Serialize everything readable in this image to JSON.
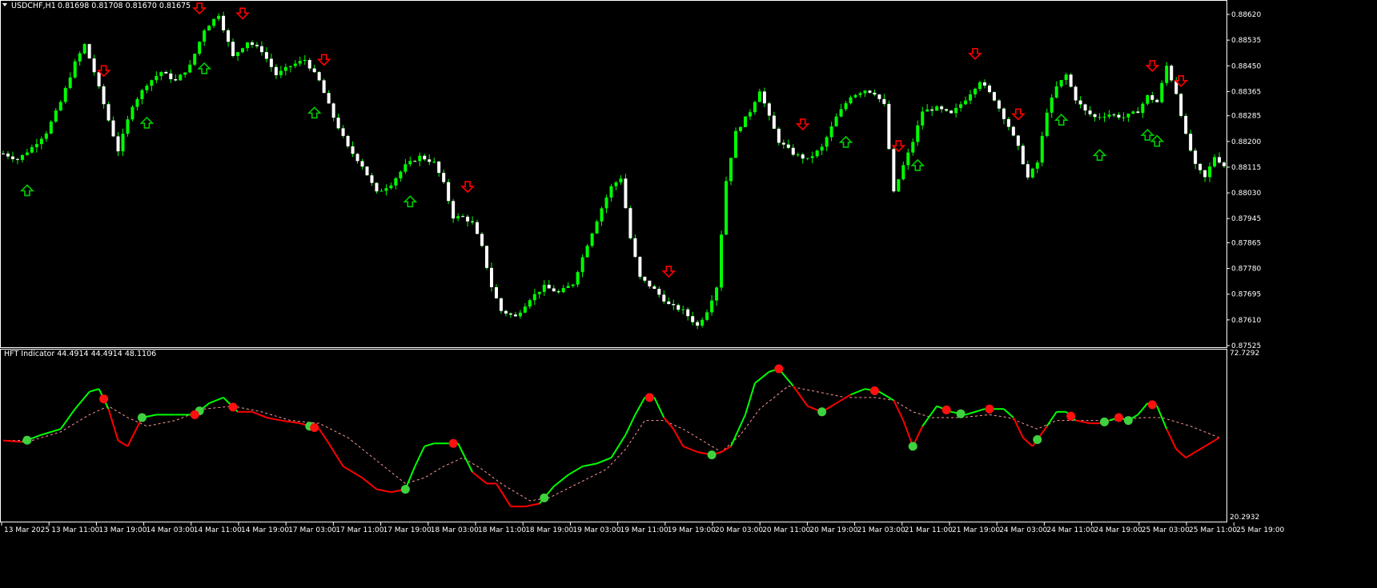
{
  "header": {
    "symbol": "USDCHF,H1",
    "ohlc": "0.81698 0.81708 0.81670 0.81675"
  },
  "indicator": {
    "title": "HFT Indicator 44.4914 44.4914 48.1106",
    "max_label": "72.7292",
    "min_label": "20.2932"
  },
  "colors": {
    "background": "#000000",
    "bull": "#00ff00",
    "bear": "#ffffff",
    "buy_arrow": "#00cc00",
    "sell_arrow": "#ff0000",
    "axis": "#ffffff",
    "signal_line": "#ff9999"
  },
  "price_axis": {
    "ticks": [
      "0.88620",
      "0.88535",
      "0.88450",
      "0.88365",
      "0.88285",
      "0.88200",
      "0.88115",
      "0.88030",
      "0.87945",
      "0.87865",
      "0.87780",
      "0.87695",
      "0.87610",
      "0.87525"
    ],
    "ylim": [
      0.87525,
      0.88665
    ]
  },
  "time_axis": {
    "labels": [
      "13 Mar 2025",
      "13 Mar 11:00",
      "13 Mar 19:00",
      "14 Mar 03:00",
      "14 Mar 11:00",
      "14 Mar 19:00",
      "17 Mar 03:00",
      "17 Mar 11:00",
      "17 Mar 19:00",
      "18 Mar 03:00",
      "18 Mar 11:00",
      "18 Mar 19:00",
      "19 Mar 03:00",
      "19 Mar 11:00",
      "19 Mar 19:00",
      "20 Mar 03:00",
      "20 Mar 11:00",
      "20 Mar 19:00",
      "21 Mar 03:00",
      "21 Mar 11:00",
      "21 Mar 19:00",
      "24 Mar 03:00",
      "24 Mar 11:00",
      "24 Mar 19:00",
      "25 Mar 03:00",
      "25 Mar 11:00",
      "25 Mar 19:00"
    ]
  },
  "chart_data": {
    "type": "candlestick",
    "title": "USDCHF,H1",
    "ylim": [
      0.87525,
      0.88665
    ],
    "close_path": [
      [
        0,
        0.8816
      ],
      [
        3,
        0.8814
      ],
      [
        6,
        0.8818
      ],
      [
        9,
        0.8823
      ],
      [
        12,
        0.8833
      ],
      [
        15,
        0.8846
      ],
      [
        17,
        0.8852
      ],
      [
        19,
        0.8843
      ],
      [
        22,
        0.8827
      ],
      [
        24,
        0.8817
      ],
      [
        27,
        0.8832
      ],
      [
        30,
        0.8839
      ],
      [
        33,
        0.8843
      ],
      [
        36,
        0.884
      ],
      [
        39,
        0.8845
      ],
      [
        42,
        0.8857
      ],
      [
        45,
        0.8862
      ],
      [
        48,
        0.8848
      ],
      [
        51,
        0.8853
      ],
      [
        54,
        0.885
      ],
      [
        57,
        0.8842
      ],
      [
        60,
        0.8845
      ],
      [
        63,
        0.8847
      ],
      [
        66,
        0.884
      ],
      [
        69,
        0.8828
      ],
      [
        72,
        0.8818
      ],
      [
        75,
        0.8812
      ],
      [
        78,
        0.8803
      ],
      [
        81,
        0.8806
      ],
      [
        84,
        0.8812
      ],
      [
        87,
        0.8815
      ],
      [
        90,
        0.8813
      ],
      [
        92,
        0.8806
      ],
      [
        94,
        0.8795
      ],
      [
        96,
        0.8795
      ],
      [
        98,
        0.8793
      ],
      [
        100,
        0.8785
      ],
      [
        102,
        0.8772
      ],
      [
        104,
        0.8764
      ],
      [
        107,
        0.8762
      ],
      [
        110,
        0.8768
      ],
      [
        113,
        0.8772
      ],
      [
        116,
        0.877
      ],
      [
        119,
        0.8773
      ],
      [
        122,
        0.8786
      ],
      [
        125,
        0.8798
      ],
      [
        127,
        0.8805
      ],
      [
        129,
        0.8808
      ],
      [
        131,
        0.8788
      ],
      [
        133,
        0.8775
      ],
      [
        136,
        0.8771
      ],
      [
        139,
        0.8766
      ],
      [
        142,
        0.8764
      ],
      [
        145,
        0.8759
      ],
      [
        147,
        0.8764
      ],
      [
        149,
        0.8772
      ],
      [
        151,
        0.8807
      ],
      [
        153,
        0.8823
      ],
      [
        156,
        0.883
      ],
      [
        158,
        0.8837
      ],
      [
        160,
        0.8828
      ],
      [
        162,
        0.882
      ],
      [
        165,
        0.8816
      ],
      [
        168,
        0.8814
      ],
      [
        171,
        0.8818
      ],
      [
        174,
        0.8828
      ],
      [
        177,
        0.8835
      ],
      [
        180,
        0.8837
      ],
      [
        182,
        0.8836
      ],
      [
        184,
        0.8832
      ],
      [
        186,
        0.8803
      ],
      [
        188,
        0.8812
      ],
      [
        190,
        0.882
      ],
      [
        192,
        0.883
      ],
      [
        195,
        0.8831
      ],
      [
        198,
        0.8829
      ],
      [
        201,
        0.8834
      ],
      [
        204,
        0.884
      ],
      [
        207,
        0.8834
      ],
      [
        210,
        0.8825
      ],
      [
        212,
        0.8818
      ],
      [
        214,
        0.8808
      ],
      [
        216,
        0.8813
      ],
      [
        218,
        0.883
      ],
      [
        220,
        0.8838
      ],
      [
        222,
        0.8842
      ],
      [
        224,
        0.8834
      ],
      [
        226,
        0.883
      ],
      [
        228,
        0.8828
      ],
      [
        231,
        0.8829
      ],
      [
        234,
        0.8828
      ],
      [
        237,
        0.883
      ],
      [
        239,
        0.8835
      ],
      [
        241,
        0.8833
      ],
      [
        243,
        0.8845
      ],
      [
        245,
        0.8836
      ],
      [
        247,
        0.8822
      ],
      [
        249,
        0.8812
      ],
      [
        251,
        0.8808
      ],
      [
        253,
        0.8815
      ],
      [
        255,
        0.8812
      ]
    ],
    "buy_signals": [
      5,
      30,
      42,
      65,
      85,
      176,
      191,
      221,
      229,
      239,
      241
    ],
    "sell_signals": [
      21,
      41,
      50,
      67,
      97,
      139,
      167,
      187,
      203,
      212,
      240,
      246
    ],
    "indicator": {
      "name": "HFT Indicator",
      "values": [
        44.4914,
        44.4914,
        48.1106
      ],
      "ylim": [
        20.2932,
        72.7292
      ],
      "main_line": [
        [
          0,
          48
        ],
        [
          4,
          47.5
        ],
        [
          8,
          50
        ],
        [
          12,
          52
        ],
        [
          15,
          59
        ],
        [
          18,
          65
        ],
        [
          20,
          66
        ],
        [
          22,
          59
        ],
        [
          24,
          48
        ],
        [
          26,
          46
        ],
        [
          29,
          56
        ],
        [
          32,
          57
        ],
        [
          36,
          57
        ],
        [
          40,
          57
        ],
        [
          43,
          61
        ],
        [
          46,
          63
        ],
        [
          49,
          58
        ],
        [
          52,
          58
        ],
        [
          55,
          56
        ],
        [
          58,
          55
        ],
        [
          62,
          54
        ],
        [
          66,
          52
        ],
        [
          68,
          47
        ],
        [
          71,
          39
        ],
        [
          75,
          35
        ],
        [
          78,
          31
        ],
        [
          81,
          30
        ],
        [
          84,
          31
        ],
        [
          86,
          39
        ],
        [
          88,
          46
        ],
        [
          90,
          47
        ],
        [
          93,
          47
        ],
        [
          95,
          47
        ],
        [
          98,
          37
        ],
        [
          101,
          33
        ],
        [
          103,
          33
        ],
        [
          106,
          25
        ],
        [
          109,
          25
        ],
        [
          112,
          26
        ],
        [
          115,
          32
        ],
        [
          118,
          36
        ],
        [
          121,
          39
        ],
        [
          124,
          40
        ],
        [
          127,
          42
        ],
        [
          130,
          50
        ],
        [
          132,
          57
        ],
        [
          134,
          63
        ],
        [
          136,
          63
        ],
        [
          138,
          56
        ],
        [
          140,
          52
        ],
        [
          142,
          46
        ],
        [
          145,
          44
        ],
        [
          148,
          43
        ],
        [
          150,
          44
        ],
        [
          152,
          46
        ],
        [
          155,
          57
        ],
        [
          157,
          68
        ],
        [
          160,
          72
        ],
        [
          162,
          73
        ],
        [
          165,
          67
        ],
        [
          168,
          60
        ],
        [
          171,
          58
        ],
        [
          174,
          61
        ],
        [
          177,
          64
        ],
        [
          180,
          66
        ],
        [
          183,
          65
        ],
        [
          186,
          62
        ],
        [
          188,
          55
        ],
        [
          190,
          46
        ],
        [
          192,
          53
        ],
        [
          195,
          60
        ],
        [
          198,
          58
        ],
        [
          201,
          57
        ],
        [
          205,
          59
        ],
        [
          209,
          59
        ],
        [
          211,
          56
        ],
        [
          213,
          49
        ],
        [
          215,
          46
        ],
        [
          218,
          53
        ],
        [
          220,
          58
        ],
        [
          222,
          58
        ],
        [
          224,
          55
        ],
        [
          227,
          54
        ],
        [
          229,
          54
        ],
        [
          231,
          55
        ],
        [
          233,
          56
        ],
        [
          235,
          55
        ],
        [
          237,
          57
        ],
        [
          239,
          61
        ],
        [
          241,
          60
        ],
        [
          243,
          52
        ],
        [
          245,
          45
        ],
        [
          247,
          42
        ],
        [
          249,
          44
        ],
        [
          251,
          46
        ],
        [
          254,
          49
        ]
      ],
      "signal_line": [
        [
          0,
          48
        ],
        [
          6,
          48
        ],
        [
          12,
          51
        ],
        [
          18,
          57
        ],
        [
          22,
          60
        ],
        [
          26,
          56
        ],
        [
          30,
          53
        ],
        [
          36,
          55
        ],
        [
          42,
          59
        ],
        [
          48,
          60
        ],
        [
          54,
          58
        ],
        [
          60,
          55
        ],
        [
          66,
          54
        ],
        [
          72,
          49
        ],
        [
          78,
          41
        ],
        [
          84,
          33
        ],
        [
          88,
          35
        ],
        [
          92,
          39
        ],
        [
          96,
          42
        ],
        [
          100,
          38
        ],
        [
          104,
          33
        ],
        [
          110,
          27
        ],
        [
          114,
          28
        ],
        [
          120,
          33
        ],
        [
          126,
          38
        ],
        [
          130,
          45
        ],
        [
          134,
          55
        ],
        [
          138,
          55
        ],
        [
          142,
          52
        ],
        [
          146,
          48
        ],
        [
          150,
          44
        ],
        [
          154,
          50
        ],
        [
          158,
          59
        ],
        [
          164,
          67
        ],
        [
          170,
          65
        ],
        [
          176,
          63
        ],
        [
          182,
          63
        ],
        [
          186,
          62
        ],
        [
          190,
          58
        ],
        [
          194,
          56
        ],
        [
          200,
          56
        ],
        [
          206,
          57
        ],
        [
          210,
          56
        ],
        [
          216,
          52
        ],
        [
          220,
          55
        ],
        [
          226,
          55
        ],
        [
          232,
          55
        ],
        [
          238,
          56
        ],
        [
          242,
          56
        ],
        [
          248,
          53
        ],
        [
          254,
          49
        ]
      ],
      "buy_dots": [
        5,
        29,
        41,
        64,
        84,
        113,
        148,
        171,
        190,
        200,
        216,
        230,
        235
      ],
      "sell_dots": [
        21,
        40,
        48,
        65,
        94,
        135,
        162,
        182,
        197,
        206,
        223,
        233,
        240
      ]
    }
  }
}
